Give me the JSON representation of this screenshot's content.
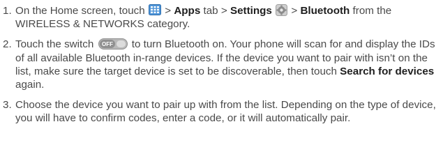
{
  "steps": [
    {
      "number": "1.",
      "seg_1": "On the Home screen, touch",
      "seg_2": ">",
      "apps": "Apps",
      "seg_3": "tab >",
      "settings": "Settings",
      "seg_4": ">",
      "bluetooth": "Bluetooth",
      "seg_5": "from the WIRELESS & NETWORKS category."
    },
    {
      "number": "2.",
      "seg_1": "Touch the switch",
      "switch_text": "OFF",
      "seg_2": "to turn Bluetooth on. Your phone will scan for and display the IDs of all available Bluetooth in-range devices. If the device you want to pair with isn’t on the list, make sure the target device is set to be discoverable, then touch",
      "search": "Search for devices",
      "seg_3": "again."
    },
    {
      "number": "3.",
      "text": "Choose the device you want to pair up with from the list. Depending on the type of device, you will have to confirm codes, enter a code, or it will automatically pair."
    }
  ],
  "icons": {
    "apps_icon": "apps-grid-icon",
    "settings_icon": "settings-gear-icon",
    "switch_icon": "toggle-switch-icon"
  },
  "colors": {
    "text": "#4a4a4a",
    "bold_text": "#1e1e1e",
    "apps_icon_blue": "#4f95d8",
    "gear_gray": "#9a9a9a",
    "switch_gray": "#8f8f8f"
  }
}
